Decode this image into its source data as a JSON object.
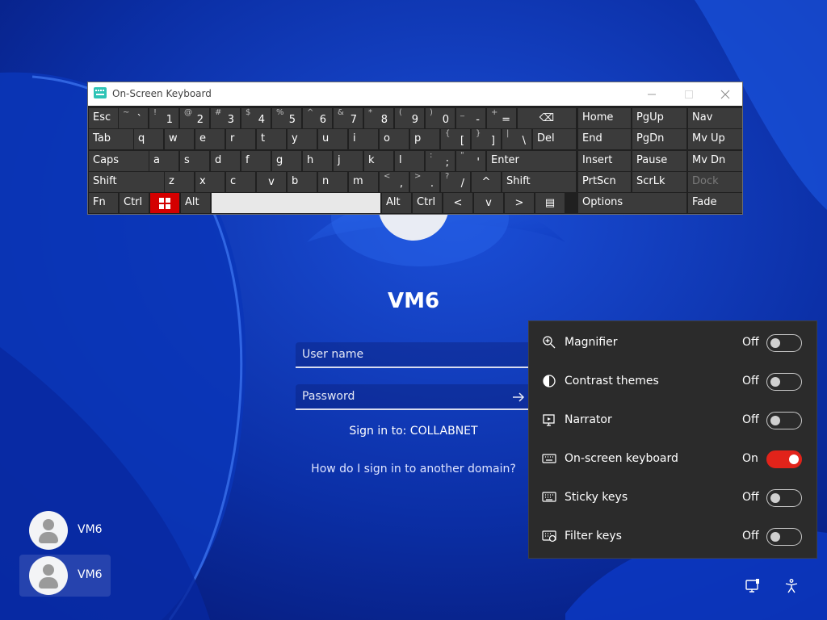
{
  "lock_screen": {
    "machine_name": "VM6",
    "username_placeholder": "User name",
    "password_placeholder": "Password",
    "sign_in_to": "Sign in to: COLLABNET",
    "other_domain_link": "How do I sign in to another domain?"
  },
  "users": [
    "VM6",
    "VM6"
  ],
  "osk": {
    "title": "On-Screen Keyboard",
    "rows": [
      [
        {
          "m": "Esc"
        },
        {
          "s": "~",
          "m": "`"
        },
        {
          "s": "!",
          "m": "1"
        },
        {
          "s": "@",
          "m": "2"
        },
        {
          "s": "#",
          "m": "3"
        },
        {
          "s": "$",
          "m": "4"
        },
        {
          "s": "%",
          "m": "5"
        },
        {
          "s": "^",
          "m": "6"
        },
        {
          "s": "&",
          "m": "7"
        },
        {
          "s": "*",
          "m": "8"
        },
        {
          "s": "(",
          "m": "9"
        },
        {
          "s": ")",
          "m": "0"
        },
        {
          "s": "_",
          "m": "-"
        },
        {
          "s": "+",
          "m": "="
        },
        {
          "m": "⌫"
        },
        {
          "m": "Home"
        },
        {
          "m": "PgUp"
        },
        {
          "m": "Nav"
        }
      ],
      [
        {
          "m": "Tab"
        },
        {
          "m": "q"
        },
        {
          "m": "w"
        },
        {
          "m": "e"
        },
        {
          "m": "r"
        },
        {
          "m": "t"
        },
        {
          "m": "y"
        },
        {
          "m": "u"
        },
        {
          "m": "i"
        },
        {
          "m": "o"
        },
        {
          "m": "p"
        },
        {
          "s": "{",
          "m": "["
        },
        {
          "s": "}",
          "m": "]"
        },
        {
          "s": "|",
          "m": "\\"
        },
        {
          "m": "Del"
        },
        {
          "m": "End"
        },
        {
          "m": "PgDn"
        },
        {
          "m": "Mv Up"
        }
      ],
      [
        {
          "m": "Caps"
        },
        {
          "m": "a"
        },
        {
          "m": "s"
        },
        {
          "m": "d"
        },
        {
          "m": "f"
        },
        {
          "m": "g"
        },
        {
          "m": "h"
        },
        {
          "m": "j"
        },
        {
          "m": "k"
        },
        {
          "m": "l"
        },
        {
          "s": ":",
          "m": ";"
        },
        {
          "s": "\"",
          "m": "'"
        },
        {
          "m": "Enter"
        },
        {
          "m": "Insert"
        },
        {
          "m": "Pause"
        },
        {
          "m": "Mv Dn"
        }
      ],
      [
        {
          "m": "Shift"
        },
        {
          "m": "z"
        },
        {
          "m": "x"
        },
        {
          "m": "c"
        },
        {
          "m": "v"
        },
        {
          "m": "b"
        },
        {
          "m": "n"
        },
        {
          "m": "m"
        },
        {
          "s": "<",
          "m": ","
        },
        {
          "s": ">",
          "m": "."
        },
        {
          "s": "?",
          "m": "/"
        },
        {
          "m": "^"
        },
        {
          "m": "Shift"
        },
        {
          "m": "PrtScn"
        },
        {
          "m": "ScrLk"
        },
        {
          "m": "Dock"
        }
      ],
      [
        {
          "m": "Fn"
        },
        {
          "m": "Ctrl"
        },
        {
          "m": "⊞"
        },
        {
          "m": "Alt"
        },
        {
          "m": ""
        },
        {
          "m": "Alt"
        },
        {
          "m": "Ctrl"
        },
        {
          "m": "<"
        },
        {
          "m": "v"
        },
        {
          "m": ">"
        },
        {
          "m": "▤"
        },
        {
          "m": "Options"
        },
        {
          "m": "Fade"
        }
      ]
    ]
  },
  "accessibility": [
    {
      "label": "Magnifier",
      "state": "Off",
      "on": false,
      "icon": "magnifier-icon"
    },
    {
      "label": "Contrast themes",
      "state": "Off",
      "on": false,
      "icon": "contrast-icon"
    },
    {
      "label": "Narrator",
      "state": "Off",
      "on": false,
      "icon": "narrator-icon"
    },
    {
      "label": "On-screen keyboard",
      "state": "On",
      "on": true,
      "icon": "keyboard-icon"
    },
    {
      "label": "Sticky keys",
      "state": "Off",
      "on": false,
      "icon": "sticky-keys-icon"
    },
    {
      "label": "Filter keys",
      "state": "Off",
      "on": false,
      "icon": "filter-keys-icon"
    }
  ],
  "colors": {
    "wallpaper": "#0a2ea8",
    "toggle_on": "#e2231a",
    "osk_key": "#3b3b3b",
    "windows_key": "#d40000"
  }
}
